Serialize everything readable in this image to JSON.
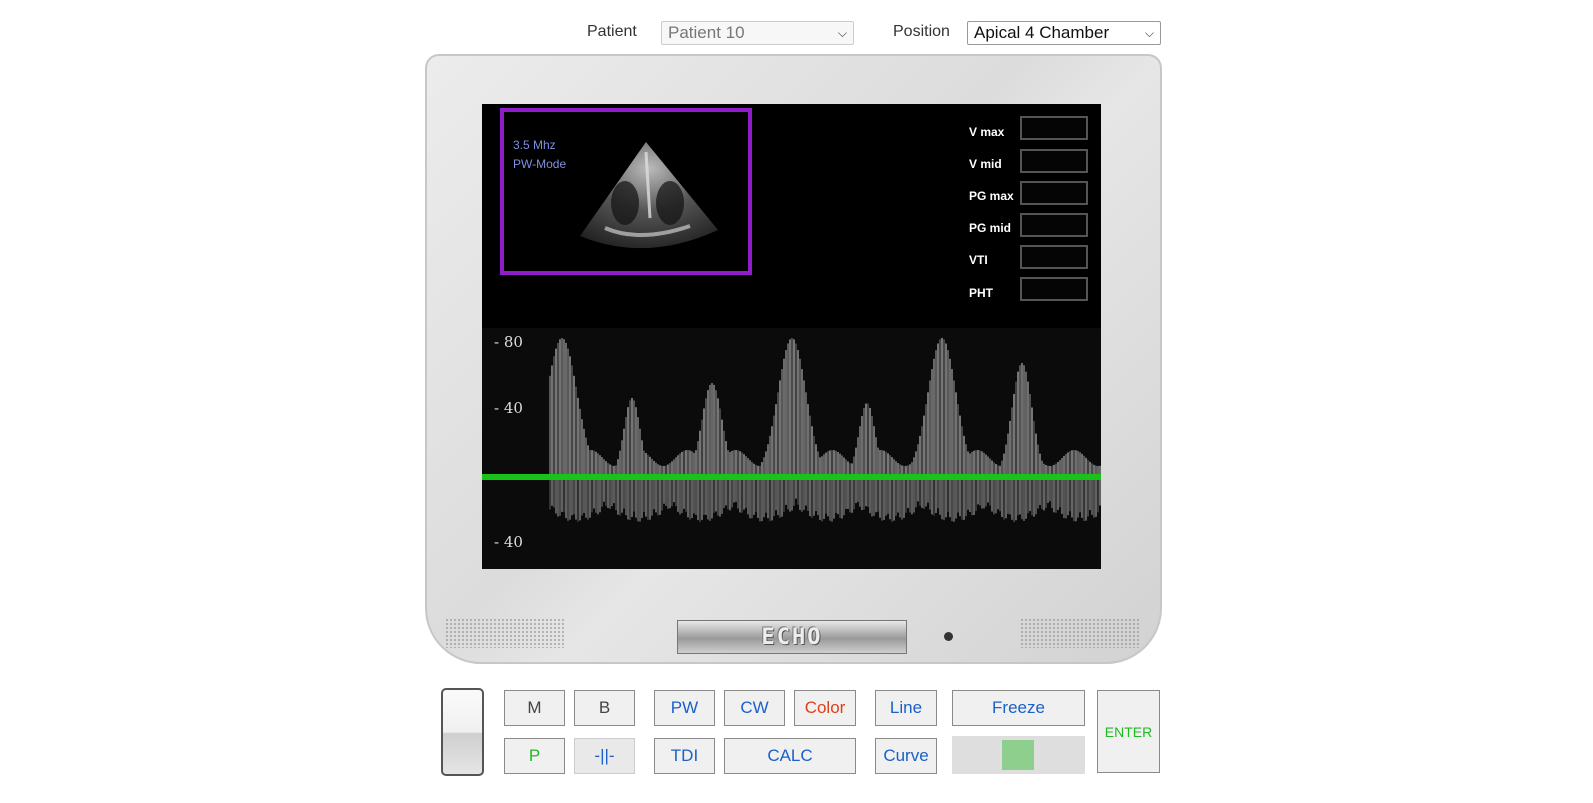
{
  "header": {
    "patient_label": "Patient",
    "patient_value": "Patient 10",
    "position_label": "Position",
    "position_value": "Apical 4 Chamber"
  },
  "screen": {
    "frequency": "3.5 Mhz",
    "mode": "PW-Mode",
    "measurements": [
      {
        "label": "V max",
        "value": ""
      },
      {
        "label": "V mid",
        "value": ""
      },
      {
        "label": "PG max",
        "value": ""
      },
      {
        "label": "PG mid",
        "value": ""
      },
      {
        "label": "VTI",
        "value": ""
      },
      {
        "label": "PHT",
        "value": ""
      }
    ],
    "scale_labels": [
      "-  80",
      "-  40",
      "-  40"
    ],
    "baseline_color": "#19c419"
  },
  "monitor": {
    "brand": "ECHO"
  },
  "controls": {
    "m": "M",
    "b": "B",
    "pw": "PW",
    "cw": "CW",
    "color": "Color",
    "line": "Line",
    "freeze": "Freeze",
    "enter": "ENTER",
    "p": "P",
    "caliper": "-||-",
    "tdi": "TDI",
    "calc": "CALC",
    "curve": "Curve"
  },
  "colors": {
    "accent_blue": "#1a60c8",
    "color_button": "#e0401a",
    "green_text": "#22b822",
    "inset_border": "#8f1ec9",
    "freeze_indicator": "#8ecf8e"
  }
}
